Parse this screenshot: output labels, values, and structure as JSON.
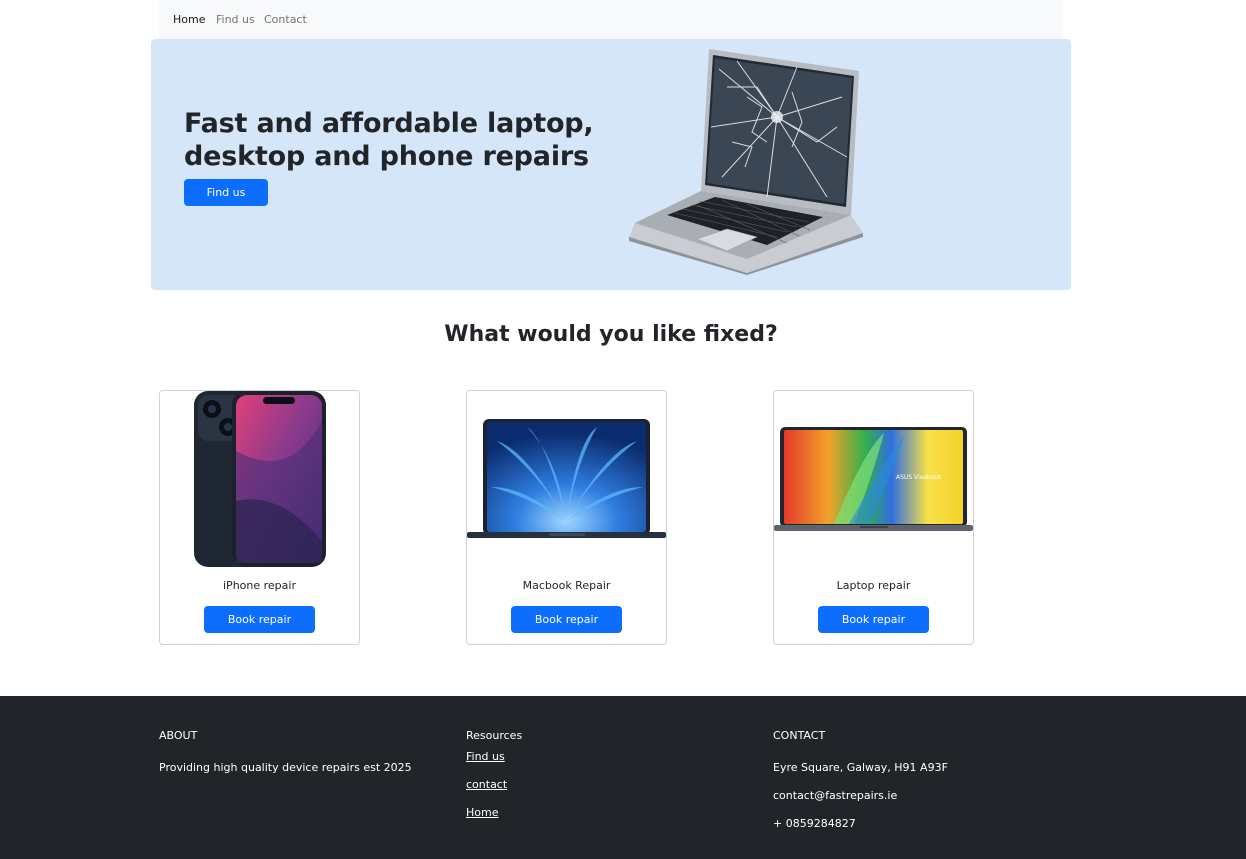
{
  "nav": {
    "items": [
      {
        "label": "Home"
      },
      {
        "label": "Find us"
      },
      {
        "label": "Contact"
      }
    ]
  },
  "hero": {
    "title_line1": "Fast and affordable laptop,",
    "title_line2": "desktop and phone repairs",
    "button_label": "Find us",
    "image": "broken-laptop-screen"
  },
  "section": {
    "heading": "What would you like fixed?"
  },
  "cards": [
    {
      "title": "iPhone repair",
      "button_label": "Book repair",
      "image": "iphone"
    },
    {
      "title": "Macbook Repair",
      "button_label": "Book repair",
      "image": "macbook-air"
    },
    {
      "title": "Laptop repair",
      "button_label": "Book repair",
      "image": "asus-vivobook"
    }
  ],
  "footer": {
    "about": {
      "heading": "ABOUT",
      "text": "Providing high quality device repairs est 2025"
    },
    "resources": {
      "heading": "Resources",
      "links": [
        {
          "label": "Find us"
        },
        {
          "label": "contact"
        },
        {
          "label": "Home"
        }
      ]
    },
    "contact": {
      "heading": "CONTACT",
      "address": "Eyre Square, Galway, H91 A93F",
      "email": "contact@fastrepairs.ie",
      "phone": "+ 0859284827"
    }
  },
  "colors": {
    "primary": "#0d6efd",
    "hero_bg": "#d5e6f8",
    "navbar_bg": "#f8f9fa",
    "footer_bg": "#212529"
  }
}
